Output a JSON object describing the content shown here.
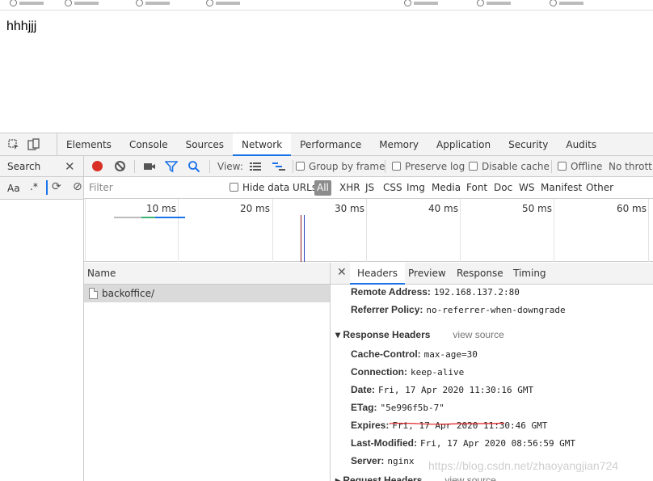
{
  "page": {
    "body_text": "hhhjjj"
  },
  "devtools": {
    "tabs": [
      "Elements",
      "Console",
      "Sources",
      "Network",
      "Performance",
      "Memory",
      "Application",
      "Security",
      "Audits"
    ],
    "active_tab": "Network"
  },
  "search_panel": {
    "title": "Search",
    "aa_label": "Aa",
    "regex_label": ".*"
  },
  "toolbar": {
    "view_label": "View:",
    "group_by_frame": "Group by frame",
    "preserve_log": "Preserve log",
    "disable_cache": "Disable cache",
    "offline": "Offline",
    "throttling": "No throttlin"
  },
  "filter": {
    "placeholder": "Filter",
    "hide_data_urls": "Hide data URLs",
    "types": [
      "All",
      "XHR",
      "JS",
      "CSS",
      "Img",
      "Media",
      "Font",
      "Doc",
      "WS",
      "Manifest",
      "Other"
    ]
  },
  "timeline": {
    "ticks": [
      "10 ms",
      "20 ms",
      "30 ms",
      "40 ms",
      "50 ms",
      "60 ms"
    ]
  },
  "request_list": {
    "header": "Name",
    "rows": [
      "backoffice/"
    ]
  },
  "details": {
    "tabs": [
      "Headers",
      "Preview",
      "Response",
      "Timing"
    ],
    "active_tab": "Headers",
    "general": [
      {
        "key": "Remote Address:",
        "value": "192.168.137.2:80"
      },
      {
        "key": "Referrer Policy:",
        "value": "no-referrer-when-downgrade"
      }
    ],
    "response_headers_title": "Response Headers",
    "view_source": "view source",
    "response_headers": [
      {
        "key": "Cache-Control:",
        "value": "max-age=30"
      },
      {
        "key": "Connection:",
        "value": "keep-alive"
      },
      {
        "key": "Date:",
        "value": "Fri, 17 Apr 2020 11:30:16 GMT"
      },
      {
        "key": "ETag:",
        "value": "\"5e996f5b-7\""
      },
      {
        "key": "Expires:",
        "value": "Fri, 17 Apr 2020 11:30:46 GMT"
      },
      {
        "key": "Last-Modified:",
        "value": "Fri, 17 Apr 2020 08:56:59 GMT"
      },
      {
        "key": "Server:",
        "value": "nginx"
      }
    ],
    "request_headers_title": "Request Headers"
  },
  "watermark": "https://blog.csdn.net/zhaoyangjian724",
  "colors": {
    "accent": "#1a73e8",
    "record": "#d93025",
    "annotation": "#e02020"
  }
}
